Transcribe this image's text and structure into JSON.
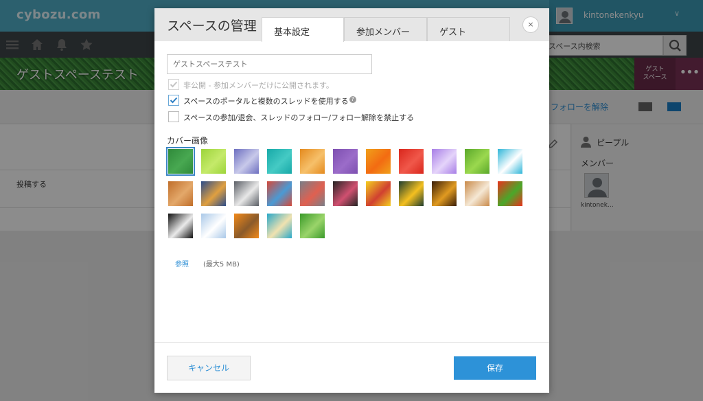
{
  "app": {
    "logo": "cybozu.com",
    "username": "kintonekenkyu",
    "search_placeholder": "スペース内検索",
    "space_title": "ゲストスペーステスト",
    "guest_badge_line1": "ゲスト",
    "guest_badge_line2": "スペース",
    "unfollow": "フォローを解除",
    "post_label": "投稿する",
    "people_title": "ピープル",
    "member_title": "メンバー",
    "member_name": "kintonek…"
  },
  "modal": {
    "title": "スペースの管理",
    "tabs": [
      {
        "label": "基本設定",
        "active": true
      },
      {
        "label": "参加メンバー",
        "active": false
      },
      {
        "label": "ゲスト",
        "active": false
      }
    ],
    "close": "×",
    "space_name_placeholder": "ゲストスペーステスト",
    "checkboxes": [
      {
        "label": "非公開 - 参加メンバーだけに公開されます。",
        "checked": true,
        "disabled": true
      },
      {
        "label": "スペースのポータルと複数のスレッドを使用する",
        "checked": true,
        "disabled": false
      },
      {
        "label": "スペースの参加/退会、スレッドのフォロー/フォロー解除を禁止する",
        "checked": false,
        "disabled": false
      }
    ],
    "help_mark": "?",
    "cover_heading": "カバー画像",
    "cover_images": [
      {
        "name": "green-grass",
        "colors": [
          "#2f8a3a",
          "#48a851"
        ],
        "selected": true
      },
      {
        "name": "lime-waves",
        "colors": [
          "#9cd43a",
          "#c5ea6a"
        ],
        "selected": false
      },
      {
        "name": "lavender-gradient",
        "colors": [
          "#6d6fc0",
          "#c8c9ea"
        ],
        "selected": false
      },
      {
        "name": "teal-texture",
        "colors": [
          "#17a9a8",
          "#45cac4"
        ],
        "selected": false
      },
      {
        "name": "orange-crumple",
        "colors": [
          "#e48a1e",
          "#f6c06a"
        ],
        "selected": false
      },
      {
        "name": "purple-texture",
        "colors": [
          "#7d4fb0",
          "#9b6cc9"
        ],
        "selected": false
      },
      {
        "name": "orange-flowers",
        "colors": [
          "#f0a01a",
          "#f36b12"
        ],
        "selected": false
      },
      {
        "name": "red-petals",
        "colors": [
          "#d9261c",
          "#f0584a"
        ],
        "selected": false
      },
      {
        "name": "violet-petals",
        "colors": [
          "#a77ee6",
          "#e5d4fa"
        ],
        "selected": false
      },
      {
        "name": "green-leaf",
        "colors": [
          "#5aa82a",
          "#9bd84e"
        ],
        "selected": false
      },
      {
        "name": "blue-cubes",
        "colors": [
          "#2fb6d8",
          "#ffffff"
        ],
        "selected": false
      },
      {
        "name": "wood-parquet",
        "colors": [
          "#c06e2a",
          "#e3a86a"
        ],
        "selected": false
      },
      {
        "name": "mosaic-tiles",
        "colors": [
          "#2c4d8a",
          "#e0a040"
        ],
        "selected": false
      },
      {
        "name": "compass-clock",
        "colors": [
          "#5b5f66",
          "#e8e8e8"
        ],
        "selected": false
      },
      {
        "name": "color-books",
        "colors": [
          "#d44a3a",
          "#4a9ad4"
        ],
        "selected": false
      },
      {
        "name": "office-clutter",
        "colors": [
          "#7a7f88",
          "#e06050"
        ],
        "selected": false
      },
      {
        "name": "chalkboard-doodles",
        "colors": [
          "#252525",
          "#d05070"
        ],
        "selected": false
      },
      {
        "name": "color-pencils",
        "colors": [
          "#f4d020",
          "#d04030"
        ],
        "selected": false
      },
      {
        "name": "lightbulb-chalk",
        "colors": [
          "#1f3d2e",
          "#f4c020"
        ],
        "selected": false
      },
      {
        "name": "sunset-gradient",
        "colors": [
          "#3a1e08",
          "#e09a20"
        ],
        "selected": false
      },
      {
        "name": "latte-art",
        "colors": [
          "#c98a4a",
          "#f5e8d5"
        ],
        "selected": false
      },
      {
        "name": "vegetables",
        "colors": [
          "#e8321c",
          "#4aa82a"
        ],
        "selected": false
      },
      {
        "name": "cat-silhouette",
        "colors": [
          "#101010",
          "#eaeaea"
        ],
        "selected": false
      },
      {
        "name": "snow-trees",
        "colors": [
          "#a9c8e8",
          "#ffffff"
        ],
        "selected": false
      },
      {
        "name": "oranges-basket",
        "colors": [
          "#f28a1a",
          "#8a5a2a"
        ],
        "selected": false
      },
      {
        "name": "beach-palm",
        "colors": [
          "#2aa8c8",
          "#f0e2b0"
        ],
        "selected": false
      },
      {
        "name": "bamboo",
        "colors": [
          "#3a9a2a",
          "#9ad46a"
        ],
        "selected": false
      }
    ],
    "browse_label": "参照",
    "size_note": "(最大5 MB)",
    "cancel_label": "キャンセル",
    "save_label": "保存"
  }
}
